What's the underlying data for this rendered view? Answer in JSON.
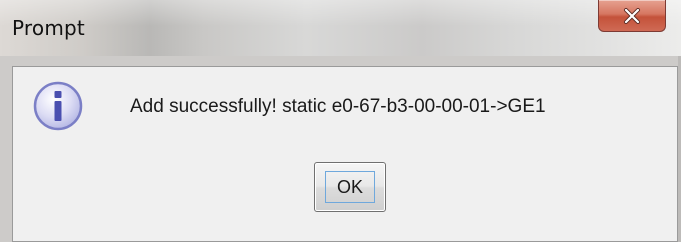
{
  "window": {
    "title": "Prompt",
    "close_icon": "close-x-icon"
  },
  "dialog": {
    "icon": "info-icon",
    "icon_glyph": "i",
    "message": "Add successfully! static e0-67-b3-00-00-01->GE1",
    "ok_label": "OK"
  },
  "colors": {
    "close_button": "#c9553d",
    "info_icon_fill": "#dcdcf4",
    "info_icon_border": "#7b7fc6",
    "info_icon_glyph": "#4a4fb0",
    "focus_ring": "#6fa8dc"
  }
}
